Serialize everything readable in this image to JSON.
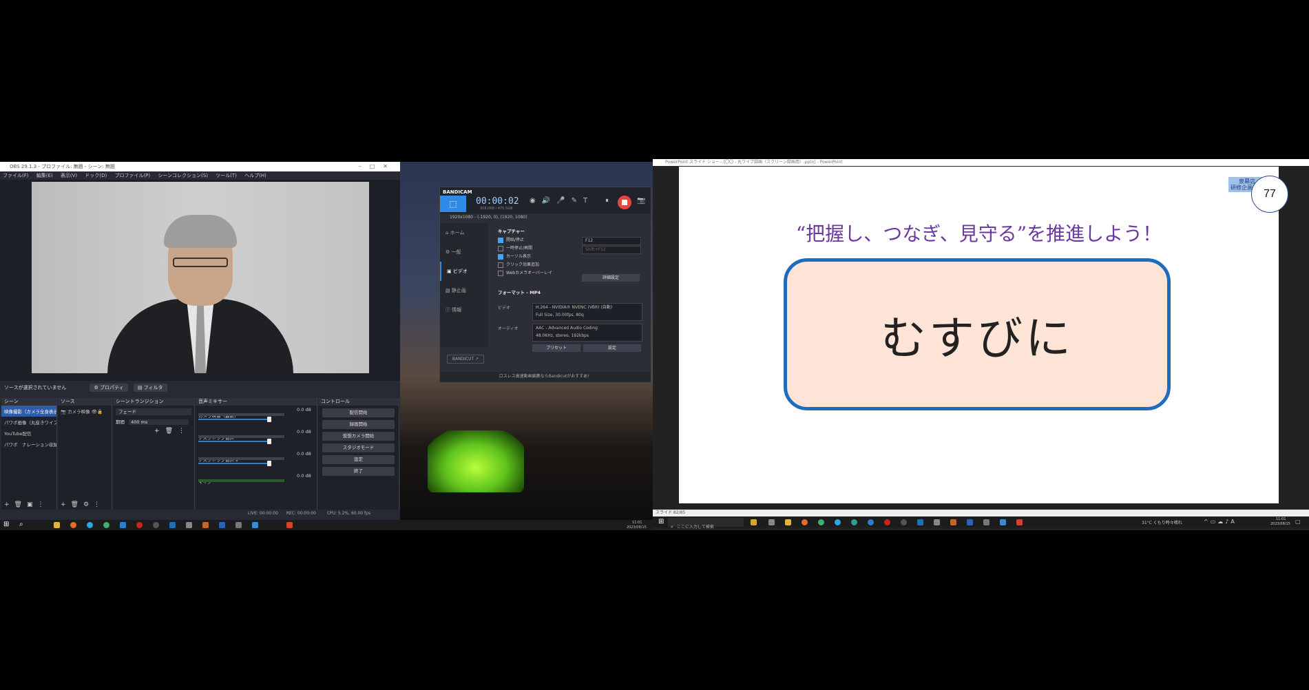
{
  "obs": {
    "title": "OBS 29.1.3 - プロファイル: 無題 - シーン: 無題",
    "menu": [
      "ファイル(F)",
      "編集(E)",
      "表示(V)",
      "ドック(D)",
      "プロファイル(P)",
      "シーンコレクション(S)",
      "ツール(T)",
      "ヘルプ(H)"
    ],
    "source_bar": {
      "status": "ソースが選択されていません",
      "properties": "プロパティ",
      "filters": "フィルタ"
    },
    "docks": {
      "scenes": {
        "title": "シーン",
        "items": [
          "映像撮影（カメラ全身表示）",
          "パワポ画像（丸抜きワイプ）",
          "YouTube配信",
          "パワポ　ナレーション収録"
        ]
      },
      "sources": {
        "title": "ソース",
        "items": [
          "カメラ映像"
        ]
      },
      "transitions": {
        "title": "シーントランジション",
        "type": "フェード",
        "duration_label": "期間",
        "duration": "400 ms"
      },
      "mixer": {
        "title": "音声ミキサー",
        "tracks": [
          {
            "name": "カメラ映像（最新）",
            "db": "0.0 dB",
            "level": 0.82
          },
          {
            "name": "デスクトップ音声",
            "db": "0.0 dB",
            "level": 0.82
          },
          {
            "name": "デスクトップ音声 2",
            "db": "0.0 dB",
            "level": 0.82
          },
          {
            "name": "マイク",
            "db": "0.0 dB",
            "level": 0.82
          }
        ]
      },
      "controls": {
        "title": "コントロール",
        "buttons": [
          "配信開始",
          "録画開始",
          "仮想カメラ開始",
          "スタジオモード",
          "設定",
          "終了"
        ]
      }
    },
    "status": {
      "live": "LIVE: 00:00:00",
      "rec": "REC: 00:00:00",
      "cpu": "CPU: 5.2%, 60.00 fps"
    }
  },
  "bandicam": {
    "brand": "BANDICAM",
    "timer": "00:00:02",
    "size": "308.0KB / 475.5GB",
    "region": "1920x1080 - (-1920, 0), (1920, 1080)",
    "nav": [
      "ホーム",
      "一般",
      "ビデオ",
      "静止画",
      "情報"
    ],
    "section_capture": "キャプチャー",
    "options": [
      {
        "label": "開始/停止",
        "checked": true
      },
      {
        "label": "一時停止/再開",
        "checked": false
      },
      {
        "label": "カーソル表示",
        "checked": true
      },
      {
        "label": "クリック効果追加",
        "checked": false
      },
      {
        "label": "Webカメラオーバーレイ",
        "checked": false
      }
    ],
    "hotkey": "F12",
    "hotkey2": "Shift+F12",
    "detail_button": "詳細設定",
    "format_title": "フォーマット - MP4",
    "video_label": "ビデオ",
    "video_value1": "H.264 - NVIDIA® NVENC (VBR) (自動)",
    "video_value2": "Full Size, 30.00fps, 80q",
    "audio_label": "オーディオ",
    "audio_value1": "AAC - Advanced Audio Coding",
    "audio_value2": "48.0KHz, stereo, 192kbps",
    "preset_button": "プリセット",
    "settings_button": "設定",
    "bandicut": "BANDICUT ↗",
    "footer": "ロスレス高速動画編集ならBandicutがおすすめ！"
  },
  "left_taskbar": {
    "time": "11:01",
    "date": "2023/08/15"
  },
  "powerpoint": {
    "title": "PowerPoint スライド ショー - [〇〇 - 丸ワイプ録画（スクリーン録画用）.pptx] - PowerPoint",
    "badge": "泉幕店\n研修企画工房",
    "slide_number": "77",
    "heading": "“把握し、つなぎ、見守る”を推進しよう！",
    "word": "むすびに",
    "status": "スライド 82/85"
  },
  "right_taskbar": {
    "search_placeholder": "ここに入力して検索",
    "weather": "31°C くもり時々晴れ",
    "time": "11:01",
    "date": "2023/08/15"
  }
}
